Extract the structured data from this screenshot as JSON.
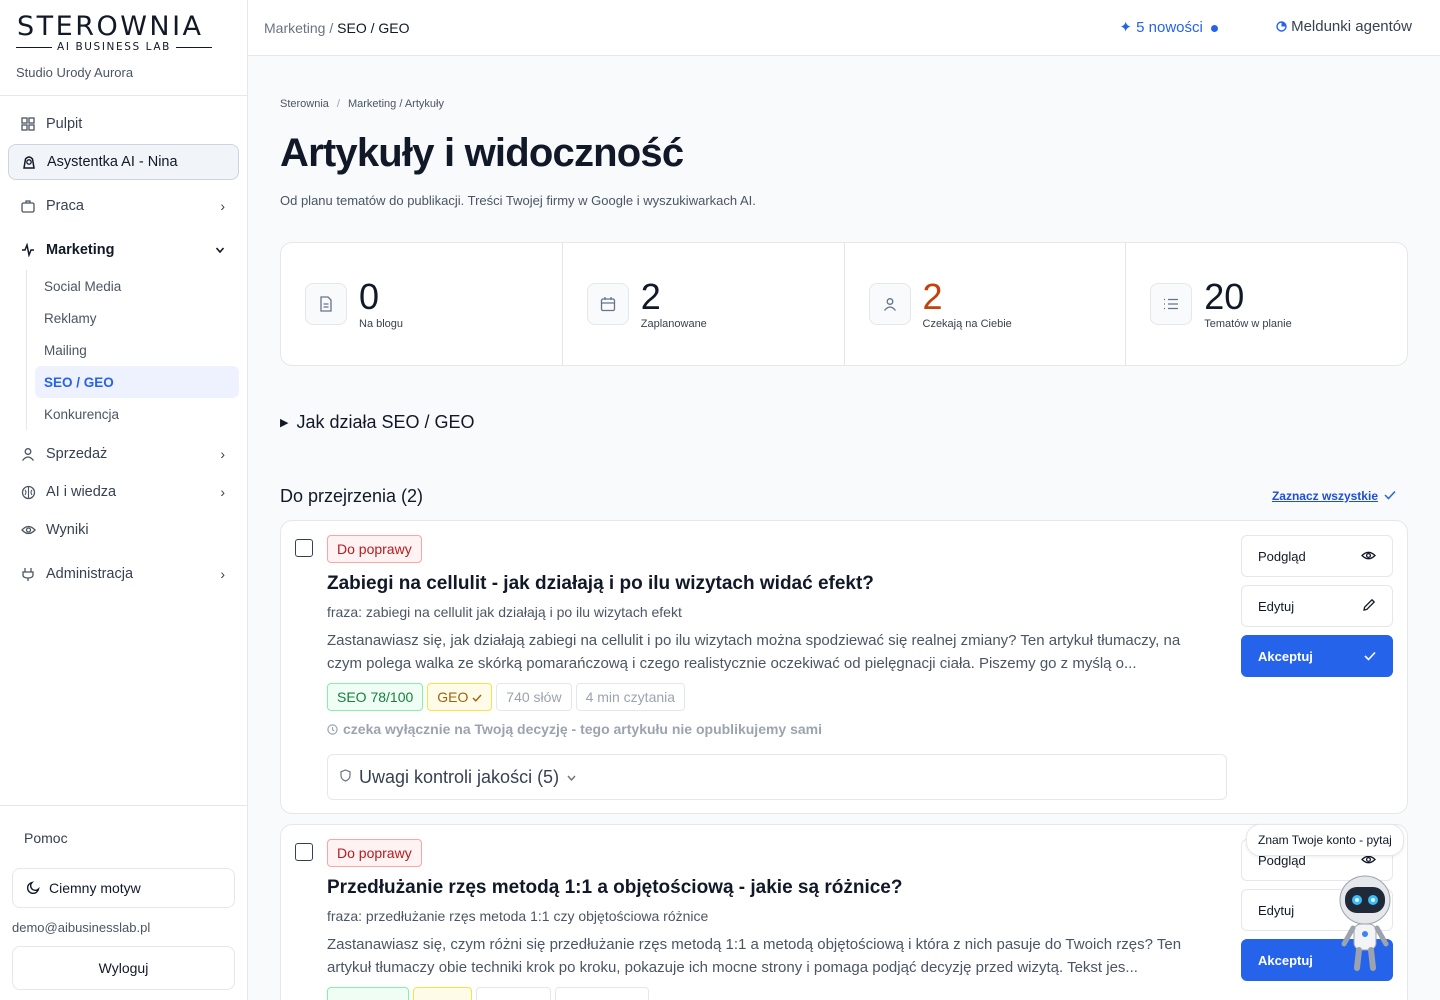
{
  "brand": {
    "logo": "STEROWNIA",
    "logo_sub": "AI BUSINESS LAB",
    "studio": "Studio Urody Aurora"
  },
  "sidebar": {
    "items": [
      {
        "label": "Pulpit",
        "icon": "grid-icon"
      },
      {
        "label": "Asystentka AI - Nina",
        "icon": "robot-icon"
      },
      {
        "label": "Praca",
        "icon": "briefcase-icon"
      },
      {
        "label": "Marketing",
        "icon": "activity-icon"
      },
      {
        "label": "Sprzedaż",
        "icon": "user-icon"
      },
      {
        "label": "AI i wiedza",
        "icon": "brain-icon"
      },
      {
        "label": "Wyniki",
        "icon": "eye-icon"
      },
      {
        "label": "Administracja",
        "icon": "plug-icon"
      }
    ],
    "marketing_sub": [
      "Social Media",
      "Reklamy",
      "Mailing",
      "SEO / GEO",
      "Konkurencja"
    ],
    "help": "Pomoc",
    "theme": "Ciemny motyw",
    "email": "demo@aibusinesslab.pl",
    "logout": "Wyloguj"
  },
  "topbar": {
    "crumb_parent": "Marketing",
    "crumb_current": "SEO / GEO",
    "news": "5 nowości",
    "reports": "Meldunki agentów"
  },
  "page": {
    "crumb_root": "Sterownia",
    "crumb_path": "Marketing / Artykuły",
    "title": "Artykuły i widoczność",
    "description": "Od planu tematów do publikacji. Treści Twojej firmy w Google i wyszukiwarkach AI."
  },
  "stats": [
    {
      "value": "0",
      "label": "Na blogu",
      "icon": "document-icon"
    },
    {
      "value": "2",
      "label": "Zaplanowane",
      "icon": "calendar-icon"
    },
    {
      "value": "2",
      "label": "Czekają na Ciebie",
      "icon": "person-icon",
      "color": "#c2410c"
    },
    {
      "value": "20",
      "label": "Tematów w planie",
      "icon": "list-icon"
    }
  ],
  "howto": "Jak działa SEO / GEO",
  "review": {
    "title": "Do przejrzenia (2)",
    "select_all": "Zaznacz wszystkie"
  },
  "articles": [
    {
      "status": "Do poprawy",
      "title": "Zabiegi na cellulit - jak działają i po ilu wizytach widać efekt?",
      "phrase": "fraza: zabiegi na cellulit jak działają i po ilu wizytach efekt",
      "excerpt": "Zastanawiasz się, jak działają zabiegi na cellulit i po ilu wizytach można spodziewać się realnej zmiany? Ten artykuł tłumaczy, na czym polega walka ze skórką pomarańczową i czego realistycznie oczekiwać od pielęgnacji ciała. Piszemy go z myślą o...",
      "seo": "SEO 78/100",
      "geo": "GEO",
      "words": "740 słów",
      "read": "4 min czytania",
      "note": "czeka wyłącznie na Twoją decyzję - tego artykułu nie opublikujemy sami",
      "qc": "Uwagi kontroli jakości (5)"
    },
    {
      "status": "Do poprawy",
      "title": "Przedłużanie rzęs metodą 1:1 a objętościową - jakie są różnice?",
      "phrase": "fraza: przedłużanie rzęs metoda 1:1 czy objętościowa różnice",
      "excerpt": "Zastanawiasz się, czym różni się przedłużanie rzęs metodą 1:1 a metodą objętościową i która z nich pasuje do Twoich rzęs? Ten artykuł tłumaczy obie techniki krok po kroku, pokazuje ich mocne strony i pomaga podjąć decyzję przed wizytą. Tekst jes..."
    }
  ],
  "actions": {
    "preview": "Podgląd",
    "edit": "Edytuj",
    "accept": "Akceptuj"
  },
  "assistant_tooltip": "Znam Twoje konto - pytaj",
  "colors": {
    "accent": "#2563eb",
    "danger": "#b91c1c",
    "warning": "#c2410c",
    "success": "#15803d"
  }
}
